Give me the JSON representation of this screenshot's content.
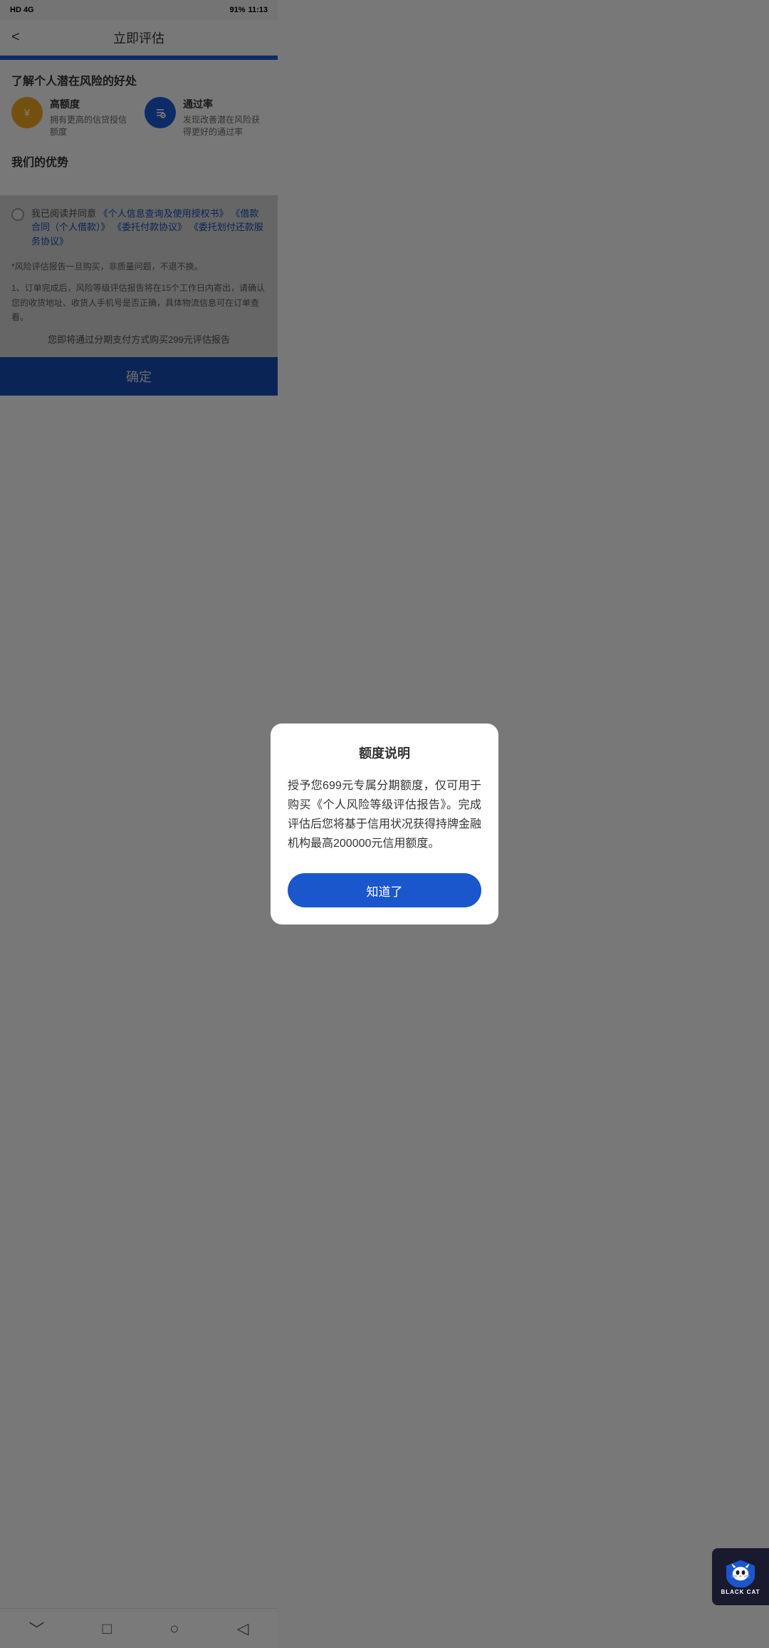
{
  "statusBar": {
    "left": "HD 4G",
    "time": "11:13",
    "battery": "91%"
  },
  "header": {
    "backLabel": "<",
    "title": "立即评估"
  },
  "benefits": {
    "sectionTitle": "了解个人潜在风险的好处",
    "items": [
      {
        "iconType": "gold",
        "iconSymbol": "💰",
        "title": "高额度",
        "desc": "拥有更高的信贷授信额度"
      },
      {
        "iconType": "blue",
        "iconSymbol": "📋",
        "title": "通过率",
        "desc": "发现改善潜在风险获得更好的通过率"
      }
    ]
  },
  "advantages": {
    "sectionTitle": "我们的优势"
  },
  "dialog": {
    "title": "额度说明",
    "body": "授予您699元专属分期额度，仅可用于购买《个人风险等级评估报告》。完成评估后您将基于信用状况获得持牌金融机构最高200000元信用额度。",
    "confirmLabel": "知道了"
  },
  "agreement": {
    "text": "我已阅读并同意",
    "links": [
      "《个人信息查询及使用授权书》",
      "《借款合同（个人借款）》",
      "《委托付款协议》",
      "《委托划付还款服务协议》"
    ]
  },
  "notes": {
    "note1": "*风险评估报告一旦购买，非质量问题，不退不换。",
    "note2": "1、订单完成后，风险等级评估报告将在15个工作日内寄出，请确认您的收货地址、收货人手机号是否正确，具体物流信息可在订单查看。"
  },
  "purchaseNote": "您即将通过分期支付方式购买299元评估报告",
  "confirmButton": {
    "label": "确定"
  },
  "bottomNav": {
    "back": "﹀",
    "home": "□",
    "circle": "○",
    "triangle": "◁"
  },
  "watermark": {
    "text": "BLACK CAT"
  }
}
